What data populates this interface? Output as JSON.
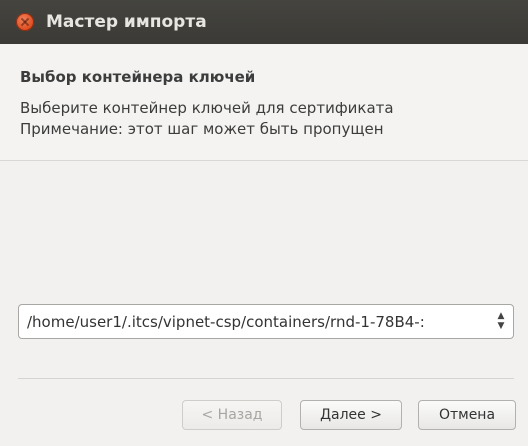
{
  "window": {
    "title": "Мастер импорта"
  },
  "header": {
    "title": "Выбор контейнера ключей",
    "line1": "Выберите контейнер ключей для сертификата",
    "line2": "Примечание: этот шаг может быть пропущен"
  },
  "container_select": {
    "value": "/home/user1/.itcs/vipnet-csp/containers/rnd-1-78B4-:"
  },
  "buttons": {
    "back": "< Назад",
    "next": "Далее >",
    "cancel": "Отмена"
  },
  "icons": {
    "close": "close-icon",
    "spin_arrows": "updown-arrows-icon"
  },
  "colors": {
    "titlebar": "#3b3a36",
    "close": "#df4a1d"
  }
}
